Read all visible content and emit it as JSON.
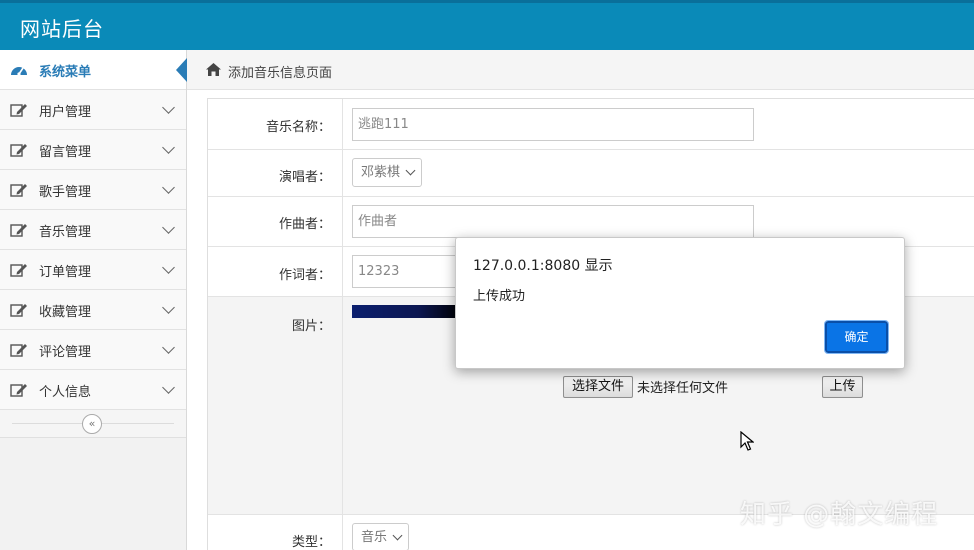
{
  "header": {
    "title": "网站后台"
  },
  "sidebar": {
    "first": {
      "label": "系统菜单",
      "icon": "dashboard-icon"
    },
    "items": [
      {
        "label": "用户管理",
        "icon": "edit-icon"
      },
      {
        "label": "留言管理",
        "icon": "edit-icon"
      },
      {
        "label": "歌手管理",
        "icon": "edit-icon"
      },
      {
        "label": "音乐管理",
        "icon": "edit-icon"
      },
      {
        "label": "订单管理",
        "icon": "edit-icon"
      },
      {
        "label": "收藏管理",
        "icon": "edit-icon"
      },
      {
        "label": "评论管理",
        "icon": "edit-icon"
      },
      {
        "label": "个人信息",
        "icon": "edit-icon"
      }
    ],
    "collapse_glyph": "«"
  },
  "breadcrumb": {
    "text": "添加音乐信息页面",
    "icon": "home-icon"
  },
  "form": {
    "music_name": {
      "label": "音乐名称：",
      "value": "逃跑111"
    },
    "singer": {
      "label": "演唱者：",
      "value": "邓紫棋"
    },
    "composer": {
      "label": "作曲者：",
      "placeholder": "作曲者"
    },
    "lyricist": {
      "label": "作词者：",
      "value": "12323"
    },
    "image": {
      "label": "图片：",
      "choose_label": "选择文件",
      "file_status": "未选择任何文件",
      "upload_label": "上传"
    },
    "type": {
      "label": "类型：",
      "value": "音乐"
    }
  },
  "dialog": {
    "title": "127.0.0.1:8080 显示",
    "message": "上传成功",
    "ok_label": "确定"
  },
  "watermark": "知乎 @翰文编程",
  "colors": {
    "header": "#0a8ab8",
    "accent": "#2a7cb6",
    "dialog_button": "#0a74e6"
  }
}
